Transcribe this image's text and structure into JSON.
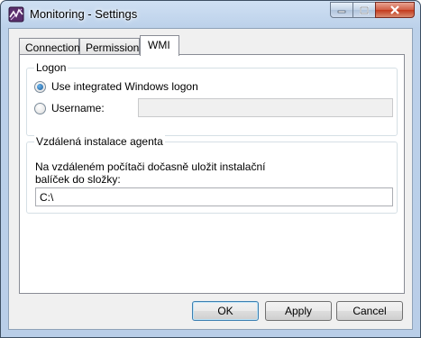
{
  "window": {
    "title": "Monitoring - Settings"
  },
  "tabs": [
    {
      "label": "Connection",
      "active": false
    },
    {
      "label": "Permissions",
      "active": false
    },
    {
      "label": "WMI",
      "active": true
    }
  ],
  "logon": {
    "legend": "Logon",
    "integrated_label": "Use integrated Windows logon",
    "username_label": "Username:",
    "username_value": "",
    "selected": "integrated"
  },
  "agent": {
    "legend": "Vzdálená instalace agenta",
    "description_line1": "Na vzdáleném počítači dočasně uložit instalační",
    "description_line2": "balíček do složky:",
    "folder_value": "C:\\"
  },
  "buttons": {
    "ok": "OK",
    "apply": "Apply",
    "cancel": "Cancel"
  }
}
